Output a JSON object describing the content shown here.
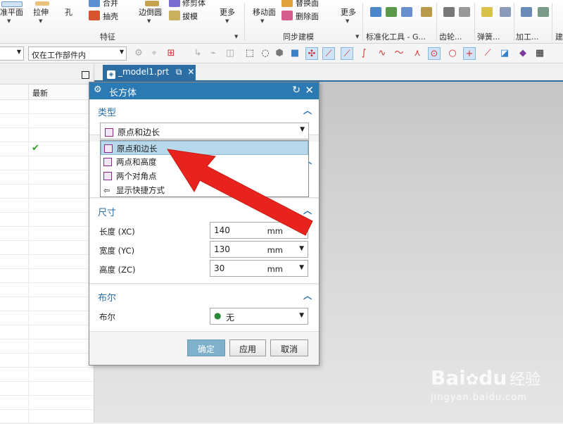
{
  "ribbon": {
    "datum_plane": "准平面",
    "extrude": "拉伸",
    "hole": "孔",
    "unite": "合并",
    "shell": "抽壳",
    "edge_blend": "边倒圆",
    "trim_body": "修剪体",
    "draft": "拔模",
    "more1": "更多",
    "group_feature": "特征",
    "move_face": "移动面",
    "replace_face": "替换面",
    "delete_face": "删除面",
    "more2": "更多",
    "group_sync": "同步建模",
    "group_std": "标准化工具 - G...",
    "group_gear": "齿轮...",
    "group_spring": "弹簧...",
    "group_machining": "加工...",
    "group_more": "建"
  },
  "toolbar2": {
    "filter_value": "仅在工作部件内"
  },
  "navigator": {
    "col_latest": "最新"
  },
  "tab": {
    "label": "_model1.prt"
  },
  "dialog": {
    "title": "长方体",
    "type_section": "类型",
    "type_value": "原点和边长",
    "type_options": [
      "原点和边长",
      "两点和高度",
      "两个对角点",
      "显示快捷方式"
    ],
    "dims_section": "尺寸",
    "length_label": "长度 (XC)",
    "length_value": "140",
    "width_label": "宽度 (YC)",
    "width_value": "130",
    "height_label": "高度 (ZC)",
    "height_value": "30",
    "unit": "mm",
    "boolean_section": "布尔",
    "boolean_label": "布尔",
    "boolean_value": "无",
    "ok": "确定",
    "apply": "应用",
    "cancel": "取消"
  },
  "watermark": {
    "brand": "Bai",
    "brand2": "du",
    "cn": "经验",
    "url": "jingyan.baidu.com"
  },
  "colors": {
    "accent": "#2b7ab3",
    "highlight": "#b7d8ea",
    "arrow": "#e8231d"
  }
}
